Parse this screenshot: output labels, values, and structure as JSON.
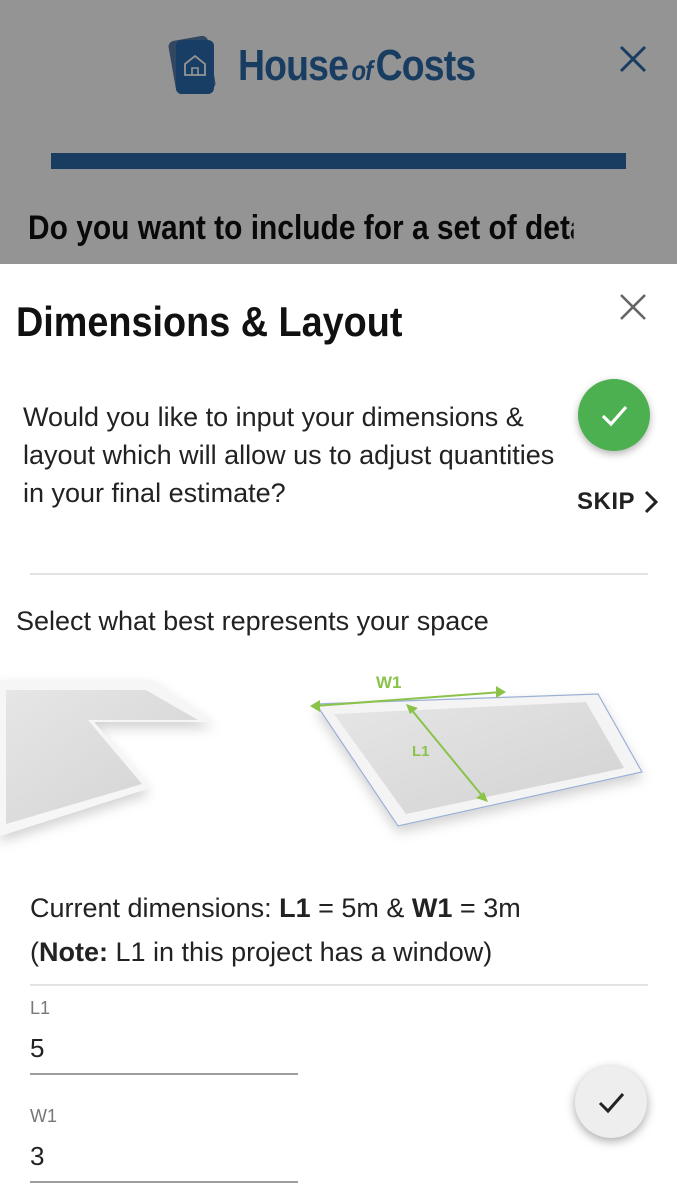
{
  "brand": {
    "name_part1": "House",
    "name_of": "of",
    "name_part2": "Costs"
  },
  "background": {
    "question": "Do you want to include for a set of detailed drawings in the project"
  },
  "modal": {
    "title": "Dimensions & Layout",
    "question": "Would you like to input your dimensions & layout which will allow us to adjust quantities in your final estimate?",
    "skip_label": "SKIP",
    "select_label": "Select what best represents your space",
    "shape_labels": {
      "w": "W1",
      "l": "L1"
    },
    "dims": {
      "prefix": "Current dimensions: ",
      "l_key": "L1",
      "l_val": " = 5m & ",
      "w_key": "W1",
      "w_val": " = 3m",
      "note_open": "(",
      "note_key": "Note:",
      "note_text": " L1 in this project has a window)"
    },
    "fields": [
      {
        "label": "L1",
        "value": "5"
      },
      {
        "label": "W1",
        "value": "3"
      }
    ]
  },
  "colors": {
    "brand_blue": "#2a6aa8",
    "accept_green": "#4caf50",
    "measure_green": "#8bc34a"
  },
  "icons": {
    "close": "close-icon",
    "check": "check-icon",
    "chevron": "chevron-right-icon"
  }
}
